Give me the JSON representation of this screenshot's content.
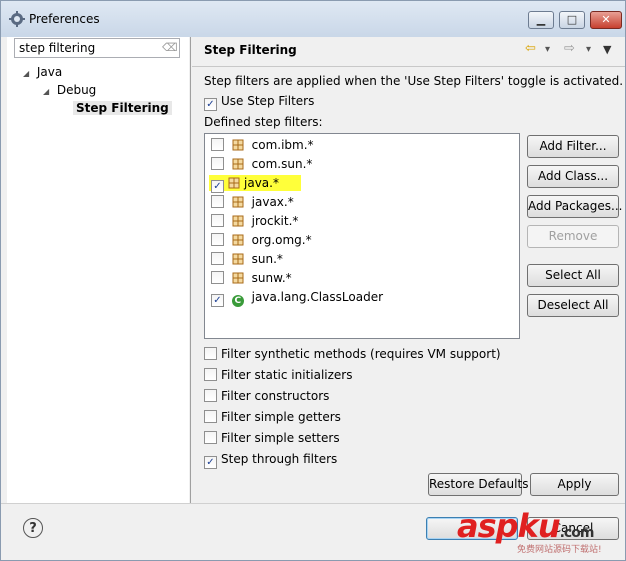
{
  "window": {
    "title": "Preferences",
    "icon": "gear-icon",
    "minimize": "▁",
    "maximize": "□",
    "close": "✕"
  },
  "filter": {
    "value": "step filtering",
    "clear_icon": "clear-icon"
  },
  "tree": {
    "java": "Java",
    "debug": "Debug",
    "step_filtering": "Step Filtering"
  },
  "page": {
    "title": "Step Filtering",
    "description": "Step filters are applied when the 'Use Step Filters' toggle is activated.",
    "use_step_filters": {
      "label": "Use Step Filters",
      "checked": true
    },
    "defined_label": "Defined step filters:"
  },
  "filters": [
    {
      "label": "com.ibm.*",
      "checked": false,
      "icon": "package-icon"
    },
    {
      "label": "com.sun.*",
      "checked": false,
      "icon": "package-icon"
    },
    {
      "label": "java.*",
      "checked": true,
      "icon": "package-icon",
      "highlight": true
    },
    {
      "label": "javax.*",
      "checked": false,
      "icon": "package-icon"
    },
    {
      "label": "jrockit.*",
      "checked": false,
      "icon": "package-icon"
    },
    {
      "label": "org.omg.*",
      "checked": false,
      "icon": "package-icon"
    },
    {
      "label": "sun.*",
      "checked": false,
      "icon": "package-icon"
    },
    {
      "label": "sunw.*",
      "checked": false,
      "icon": "package-icon"
    },
    {
      "label": "java.lang.ClassLoader",
      "checked": true,
      "icon": "class-icon"
    }
  ],
  "buttons": {
    "add_filter": "Add Filter...",
    "add_class": "Add Class...",
    "add_packages": "Add Packages...",
    "remove": "Remove",
    "select_all": "Select All",
    "deselect_all": "Deselect All",
    "restore_defaults": "Restore Defaults",
    "apply": "Apply",
    "cancel": "Cancel"
  },
  "options": [
    {
      "label": "Filter synthetic methods (requires VM support)",
      "checked": false
    },
    {
      "label": "Filter static initializers",
      "checked": false
    },
    {
      "label": "Filter constructors",
      "checked": false
    },
    {
      "label": "Filter simple getters",
      "checked": false
    },
    {
      "label": "Filter simple setters",
      "checked": false
    },
    {
      "label": "Step through filters",
      "checked": true
    }
  ],
  "nav": {
    "back": "⇦",
    "forward": "⇨",
    "dropdown": "▾",
    "menu": "▼"
  },
  "watermark": {
    "text": "aspku",
    "suffix": ".com",
    "subtitle": "免费网站源码下载站!"
  }
}
